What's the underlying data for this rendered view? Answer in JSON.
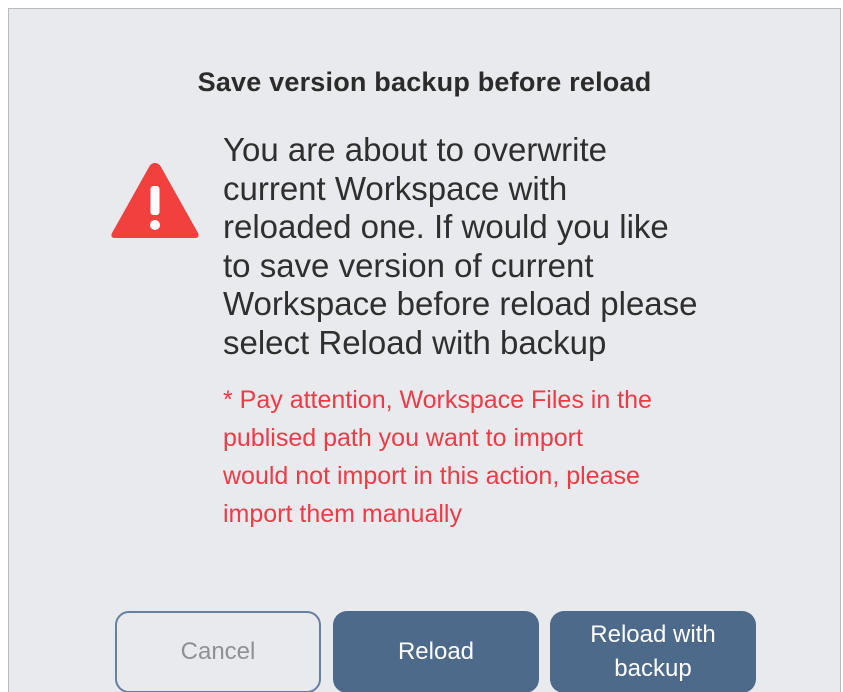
{
  "dialog": {
    "title": "Save version backup before reload",
    "message": "You are about to overwrite\ncurrent Workspace with\nreloaded one. If would you like\nto save version of current\nWorkspace before reload please\nselect Reload with backup",
    "attention": "* Pay attention, Workspace Files in the\npublised path you want to import\nwould not import in this action, please\nimport them manually",
    "icon": "warning-triangle-icon"
  },
  "buttons": {
    "cancel_label": "Cancel",
    "reload_label": "Reload",
    "backup_label": "Reload with\nbackup"
  },
  "colors": {
    "background": "#e8eaed",
    "warning_red": "#f03a45",
    "primary_button": "#4e6a8b",
    "cancel_border": "#64819f"
  }
}
